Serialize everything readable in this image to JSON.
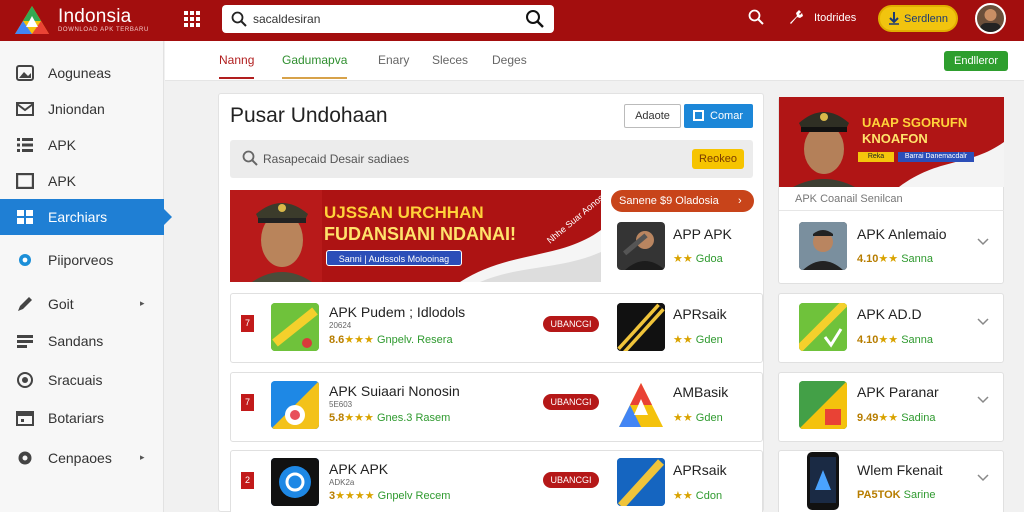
{
  "topbar": {
    "brand": "Indonsia",
    "brand_sub": "DOWNLOAD APK TERBARU",
    "search_text": "sacaldesiran",
    "user_label": "Itodrides",
    "download_btn": "Serdlenn",
    "colors": {
      "bar": "#a30e0e",
      "btn": "#f1c40f"
    }
  },
  "sidebar": {
    "items": [
      {
        "label": "Aoguneas",
        "icon": "image-icon"
      },
      {
        "label": "Jniondan",
        "icon": "mail-icon"
      },
      {
        "label": "APK",
        "icon": "list-icon"
      },
      {
        "label": "APK",
        "icon": "box-icon"
      },
      {
        "label": "Earchiars",
        "icon": "grid-icon",
        "active": true
      },
      {
        "label": "Piiporveos",
        "icon": "gear-icon"
      },
      {
        "label": "Goit",
        "icon": "pen-icon",
        "caret": "▸"
      },
      {
        "label": "Sandans",
        "icon": "card-icon"
      },
      {
        "label": "Sracuais",
        "icon": "target-icon"
      },
      {
        "label": "Botariars",
        "icon": "calendar-icon"
      },
      {
        "label": "Cenpaoes",
        "icon": "settings-icon",
        "caret": "▸"
      }
    ]
  },
  "tabs": [
    {
      "label": "Nanng"
    },
    {
      "label": "Gadumapva"
    },
    {
      "label": "Enary"
    },
    {
      "label": "Sleces"
    },
    {
      "label": "Deges"
    }
  ],
  "tab_button": "Endlleror",
  "main": {
    "title": "Pusar Undohaan",
    "btn_outline": "Adaote",
    "btn_primary": "Comar",
    "search_placeholder": "Rasapecaid Desair sadiaes",
    "search_btn": "Reokeo"
  },
  "banner": {
    "line1": "UJSSAN URCHHAN",
    "line2": "FUDANSIANI NDANAI!",
    "pill": "Sanni | Audssols Molooinag",
    "side": "Nhhe Suar Aonos"
  },
  "featured": {
    "pill": "Sanene $9 Oladosia",
    "chevron": "›",
    "name": "APP APK",
    "stars": "★★",
    "source": "Gdoa"
  },
  "list": [
    {
      "rank": "7",
      "name": "APK Pudem ; Idlodols",
      "sub": "20624",
      "score": "8.6",
      "stars": "★★★",
      "meta": "Gnpelv. Resera",
      "pill": "UBANCGI",
      "right_name": "APRsaik",
      "right_stars": "★★",
      "right_source": "Gden"
    },
    {
      "rank": "7",
      "name": "APK Suiaari Nonosin",
      "sub": "5E603",
      "score": "5.8",
      "stars": "★★★",
      "meta": "Gnes.3 Rasem",
      "pill": "UBANCGI",
      "right_name": "AMBasik",
      "right_stars": "★★",
      "right_source": "Gden"
    },
    {
      "rank": "2",
      "name": "APK APK",
      "sub": "ADK2a",
      "score": "3",
      "stars": "★★★★",
      "meta": "Gnpelv Recem",
      "pill": "UBANCGI",
      "right_name": "APRsaik",
      "right_stars": "★★",
      "right_source": "Cdon"
    }
  ],
  "right_banner": {
    "line1": "UAAP SGORUFN",
    "line2": "KNOAFON",
    "pill1": "Reka",
    "pill2": "Barrai Danemacdalr"
  },
  "right_header": "APK Coanail Senilcan",
  "right_list": [
    {
      "name": "APK Anlemaio",
      "score": "4.10",
      "stars": "★★",
      "source": "Sanna"
    },
    {
      "name": "APK AD.D",
      "score": "4.10",
      "stars": "★★",
      "source": "Sanna"
    },
    {
      "name": "APK Paranar",
      "score": "9.49",
      "stars": "★★",
      "source": "Sadina"
    },
    {
      "name": "Wlem Fkenait",
      "score": "PA5TOK",
      "stars": "",
      "source": "Sarine"
    }
  ]
}
